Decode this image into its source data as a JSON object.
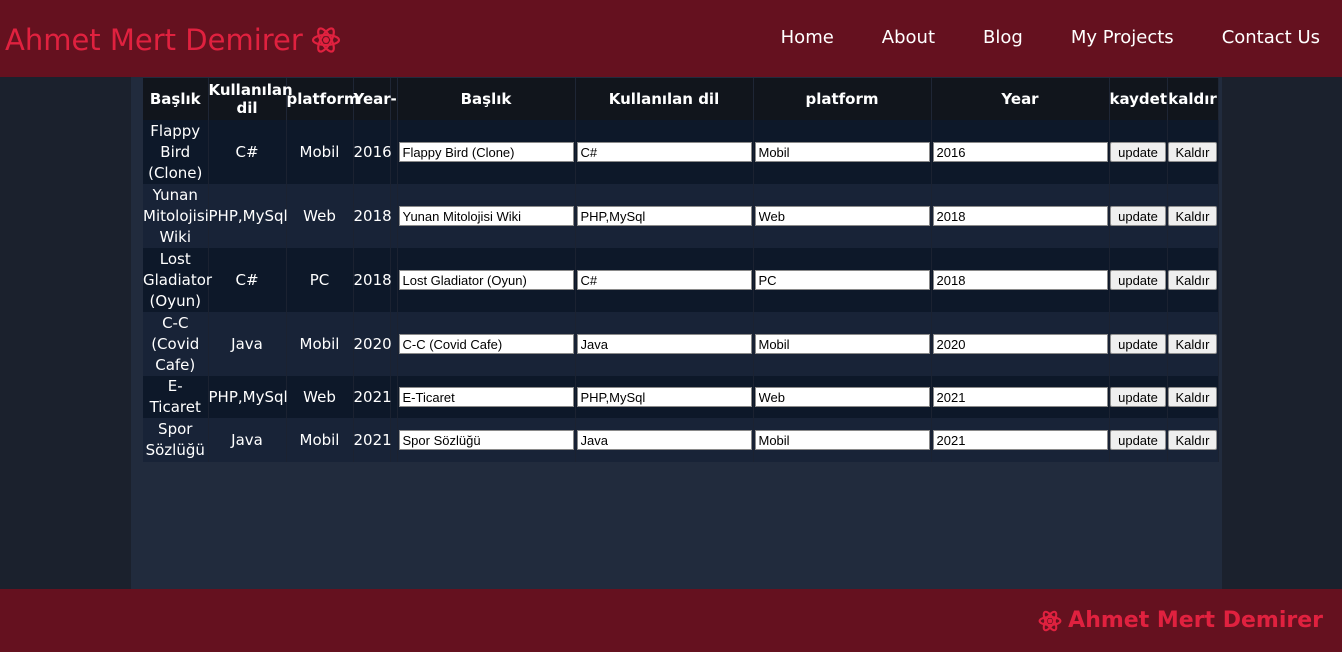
{
  "header": {
    "brand": "Ahmet Mert Demirer",
    "nav": [
      "Home",
      "About",
      "Blog",
      "My Projects",
      "Contact Us"
    ]
  },
  "table": {
    "headers": [
      "Başlık",
      "Kullanılan dil",
      "platform",
      "Year",
      "-",
      "Başlık",
      "Kullanılan dil",
      "platform",
      "Year",
      "kaydet",
      "kaldır"
    ],
    "rows": [
      {
        "title": "Flappy Bird (Clone)",
        "lang": "C#",
        "platform": "Mobil",
        "year": "2016"
      },
      {
        "title": "Yunan Mitolojisi Wiki",
        "lang": "PHP,MySql",
        "platform": "Web",
        "year": "2018"
      },
      {
        "title": "Lost Gladiator (Oyun)",
        "lang": "C#",
        "platform": "PC",
        "year": "2018"
      },
      {
        "title": "C-C (Covid Cafe)",
        "lang": "Java",
        "platform": "Mobil",
        "year": "2020"
      },
      {
        "title": "E-Ticaret",
        "lang": "PHP,MySql",
        "platform": "Web",
        "year": "2021"
      },
      {
        "title": "Spor Sözlüğü",
        "lang": "Java",
        "platform": "Mobil",
        "year": "2021"
      }
    ],
    "update_label": "update",
    "remove_label": "Kaldır"
  },
  "footer": {
    "brand": "Ahmet Mert Demirer"
  },
  "colors": {
    "header_bg": "#65111f",
    "brand": "#e0213f",
    "page_bg": "#1b212d",
    "main_bg": "#212b3d"
  },
  "icons": {
    "brand": "atom-icon"
  }
}
